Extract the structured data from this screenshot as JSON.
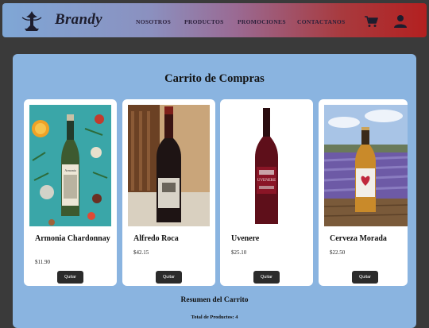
{
  "header": {
    "brand": "Brandy",
    "nav": [
      "NOSOTROS",
      "PRODUCTOS",
      "PROMOCIONES",
      "CONTACTANOS"
    ],
    "icons": [
      "logo-icon",
      "cart-icon",
      "user-icon"
    ]
  },
  "cart": {
    "title": "Carrito de Compras",
    "items": [
      {
        "name": "Armonia Chardonnay",
        "price": "$11.90",
        "button": "Quitar"
      },
      {
        "name": "Alfredo Roca",
        "price": "$42.15",
        "button": "Quitar"
      },
      {
        "name": "Uvenere",
        "price": "$25.10",
        "button": "Quitar"
      },
      {
        "name": "Cerveza Morada",
        "price": "$22.50",
        "button": "Quitar"
      }
    ]
  },
  "summary": {
    "title": "Resumen del Carrito",
    "total": "Total de Productos: 4"
  },
  "colors": {
    "panel": "#8ab4e0",
    "nav_start": "#7fa7d6",
    "nav_end": "#b32020",
    "button": "#2b2b2b"
  }
}
